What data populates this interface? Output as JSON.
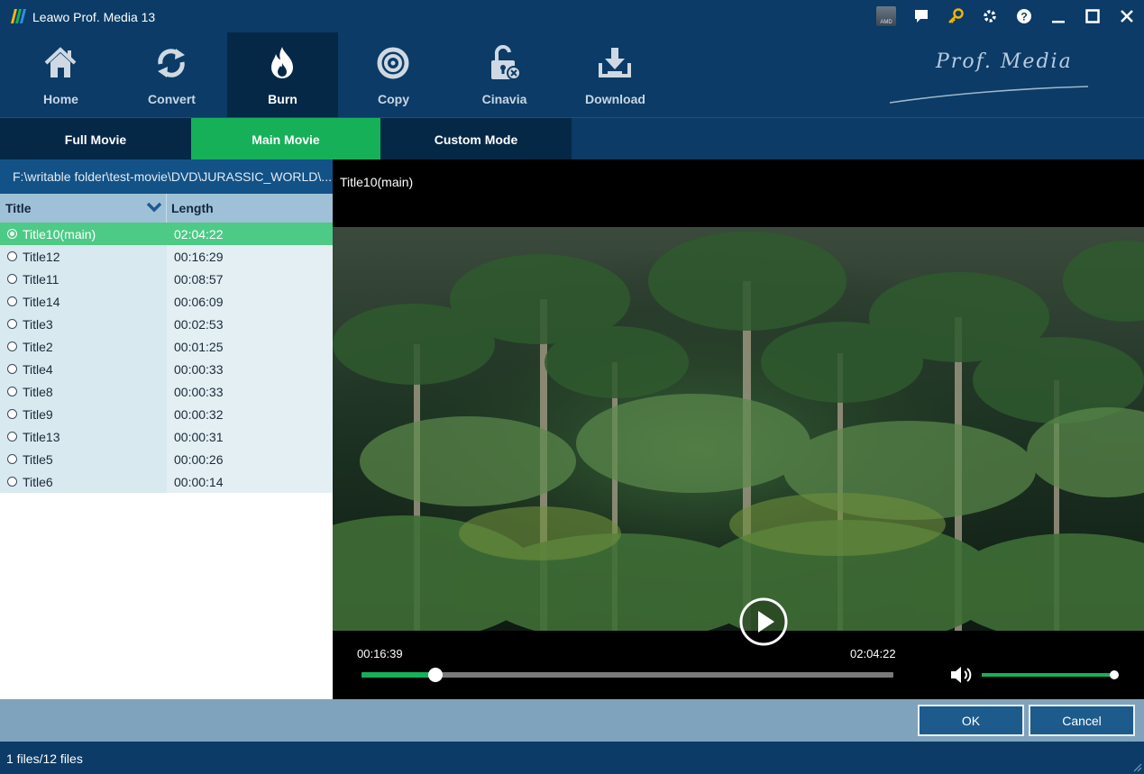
{
  "window": {
    "title": "Leawo Prof. Media 13",
    "title_icons": [
      "amd-icon",
      "chat-icon",
      "key-icon",
      "gear-icon",
      "help-icon",
      "minimize-icon",
      "maximize-icon",
      "close-icon"
    ]
  },
  "nav": {
    "items": [
      {
        "label": "Home",
        "icon": "home-icon"
      },
      {
        "label": "Convert",
        "icon": "convert-icon"
      },
      {
        "label": "Burn",
        "icon": "flame-icon",
        "active": true
      },
      {
        "label": "Copy",
        "icon": "disc-icon"
      },
      {
        "label": "Cinavia",
        "icon": "unlock-icon"
      },
      {
        "label": "Download",
        "icon": "download-icon"
      }
    ],
    "brand": "Prof. Media"
  },
  "modes": {
    "tabs": [
      "Full Movie",
      "Main Movie",
      "Custom Mode"
    ],
    "active": "Main Movie"
  },
  "source": {
    "path": "F:\\writable folder\\test-movie\\DVD\\JURASSIC_WORLD\\..."
  },
  "list": {
    "col_title": "Title",
    "col_length": "Length",
    "rows": [
      {
        "title": "Title10(main)",
        "length": "02:04:22",
        "selected": true
      },
      {
        "title": "Title12",
        "length": "00:16:29"
      },
      {
        "title": "Title11",
        "length": "00:08:57"
      },
      {
        "title": "Title14",
        "length": "00:06:09"
      },
      {
        "title": "Title3",
        "length": "00:02:53"
      },
      {
        "title": "Title2",
        "length": "00:01:25"
      },
      {
        "title": "Title4",
        "length": "00:00:33"
      },
      {
        "title": "Title8",
        "length": "00:00:33"
      },
      {
        "title": "Title9",
        "length": "00:00:32"
      },
      {
        "title": "Title13",
        "length": "00:00:31"
      },
      {
        "title": "Title5",
        "length": "00:00:26"
      },
      {
        "title": "Title6",
        "length": "00:00:14"
      }
    ]
  },
  "player": {
    "title": "Title10(main)",
    "current_time": "00:16:39",
    "total_time": "02:04:22",
    "progress": 0.139,
    "volume": 0.99
  },
  "actions": {
    "ok": "OK",
    "cancel": "Cancel"
  },
  "status": {
    "text": "1 files/12 files"
  },
  "colors": {
    "accent_green": "#16b059",
    "selected_row": "#4dca86",
    "navy": "#0b3b66",
    "button_blue": "#1c5b8c"
  }
}
